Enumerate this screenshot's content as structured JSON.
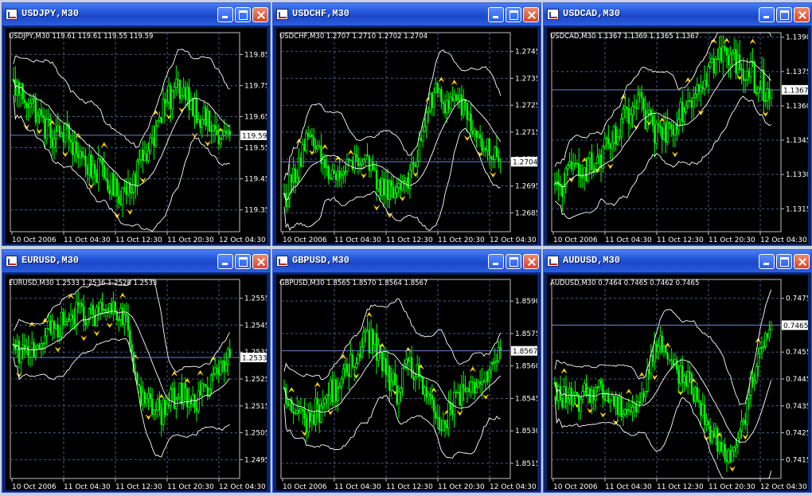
{
  "chart_data": [
    {
      "type": "candlestick",
      "window_title": "USDJPY,M30",
      "info": "USDJPY,M30  119.61 119.61 119.55 119.59",
      "current_price": "119.59",
      "price_ticks": [
        "119.85",
        "119.75",
        "119.65",
        "119.55",
        "119.45",
        "119.35"
      ],
      "x_ticks": [
        "10 Oct 2006",
        "11 Oct 04:30",
        "11 Oct 12:30",
        "11 Oct 20:30",
        "12 Oct 04:30"
      ],
      "ylim": [
        119.28,
        119.92
      ],
      "path": [
        119.75,
        119.72,
        119.68,
        119.62,
        119.58,
        119.6,
        119.55,
        119.5,
        119.48,
        119.45,
        119.4,
        119.42,
        119.48,
        119.55,
        119.62,
        119.7,
        119.75,
        119.72,
        119.66,
        119.62,
        119.58,
        119.59
      ],
      "indicators": "Bollinger Bands, Fractals",
      "colors": {
        "candle": "#00ff00",
        "band": "#ffffff",
        "fractal": "#ffd700",
        "grid": "#4a5a8a",
        "hline": "#7080c0"
      }
    },
    {
      "type": "candlestick",
      "window_title": "USDCHF,M30",
      "info": "USDCHF,M30  1.2707 1.2710 1.2702 1.2704",
      "current_price": "1.2704",
      "price_ticks": [
        "1.2745",
        "1.2735",
        "1.2725",
        "1.2715",
        "1.2705",
        "1.2695",
        "1.2685"
      ],
      "x_ticks": [
        "10 Oct 2006",
        "11 Oct 04:30",
        "11 Oct 12:30",
        "11 Oct 20:30",
        "12 Oct 04:30"
      ],
      "ylim": [
        1.2678,
        1.2752
      ],
      "path": [
        1.269,
        1.27,
        1.2712,
        1.2708,
        1.27,
        1.2698,
        1.2702,
        1.2706,
        1.27,
        1.2695,
        1.2693,
        1.2697,
        1.27,
        1.272,
        1.273,
        1.2725,
        1.2728,
        1.272,
        1.2712,
        1.2708,
        1.2704
      ]
    },
    {
      "type": "candlestick",
      "window_title": "USDCAD,M30",
      "info": "USDCAD,M30  1.1367 1.1369 1.1365 1.1367",
      "current_price": "1.1367",
      "price_ticks": [
        "1.1390",
        "1.1375",
        "1.1360",
        "1.1345",
        "1.1330",
        "1.1315"
      ],
      "x_ticks": [
        "10 Oct 2006",
        "11 Oct 04:30",
        "11 Oct 12:30",
        "11 Oct 20:30",
        "12 Oct 04:30"
      ],
      "ylim": [
        1.1305,
        1.1392
      ],
      "path": [
        1.1322,
        1.1328,
        1.1335,
        1.1333,
        1.1338,
        1.1345,
        1.1355,
        1.136,
        1.135,
        1.1348,
        1.1355,
        1.1362,
        1.137,
        1.1378,
        1.1382,
        1.138,
        1.1375,
        1.137,
        1.1367
      ]
    },
    {
      "type": "candlestick",
      "window_title": "EURUSD,M30",
      "info": "EURUSD,M30  1.2533 1.2536 1.2528 1.2533",
      "current_price": "1.2533",
      "price_ticks": [
        "1.2555",
        "1.2545",
        "1.2535",
        "1.2525",
        "1.2515",
        "1.2505",
        "1.2495"
      ],
      "x_ticks": [
        "10 Oct 2006",
        "11 Oct 04:30",
        "11 Oct 12:30",
        "11 Oct 20:30",
        "12 Oct 04:30"
      ],
      "ylim": [
        1.2488,
        1.2562
      ],
      "path": [
        1.2535,
        1.2534,
        1.2538,
        1.2542,
        1.2545,
        1.2548,
        1.255,
        1.2548,
        1.2551,
        1.2549,
        1.2545,
        1.252,
        1.2515,
        1.2512,
        1.2518,
        1.252,
        1.2516,
        1.2522,
        1.2528,
        1.2533
      ]
    },
    {
      "type": "candlestick",
      "window_title": "GBPUSD,M30",
      "info": "GBPUSD,M30  1.8565 1.8570 1.8564 1.8567",
      "current_price": "1.8567",
      "price_ticks": [
        "1.8590",
        "1.8575",
        "1.8560",
        "1.8545",
        "1.8530",
        "1.8515"
      ],
      "x_ticks": [
        "10 Oct 2006",
        "11 Oct 04:30",
        "11 Oct 12:30",
        "11 Oct 20:30",
        "12 Oct 04:30"
      ],
      "ylim": [
        1.8508,
        1.86
      ],
      "path": [
        1.8545,
        1.8538,
        1.8535,
        1.854,
        1.8548,
        1.8552,
        1.856,
        1.8575,
        1.857,
        1.8555,
        1.8548,
        1.856,
        1.8555,
        1.8538,
        1.8532,
        1.8542,
        1.855,
        1.8548,
        1.856,
        1.8567
      ]
    },
    {
      "type": "candlestick",
      "window_title": "AUDUSD,M30",
      "info": "AUDUSD,M30  0.7464 0.7465 0.7462 0.7465",
      "current_price": "0.7465",
      "price_ticks": [
        "0.7475",
        "0.7465",
        "0.7455",
        "0.7445",
        "0.7435",
        "0.7425",
        "0.7415"
      ],
      "x_ticks": [
        "10 Oct 2006",
        "11 Oct 04:30",
        "11 Oct 12:30",
        "11 Oct 20:30",
        "12 Oct 04:30"
      ],
      "ylim": [
        1.0,
        1.0
      ],
      "ylim_note": "",
      "path": [
        0.744,
        0.7438,
        0.7436,
        0.744,
        0.7442,
        0.7438,
        0.7435,
        0.7434,
        0.7436,
        0.7455,
        0.7458,
        0.745,
        0.7445,
        0.744,
        0.7428,
        0.7422,
        0.7418,
        0.742,
        0.744,
        0.7458,
        0.7465
      ]
    }
  ]
}
